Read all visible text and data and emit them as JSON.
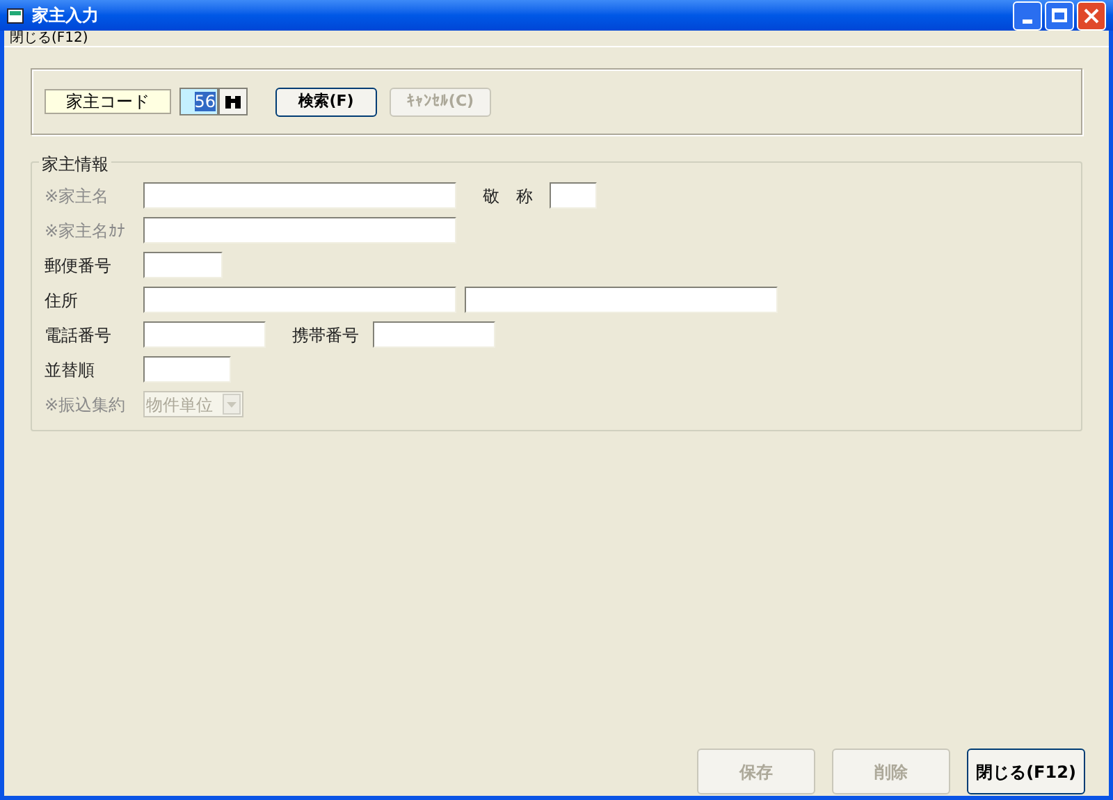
{
  "window": {
    "title": "家主入力"
  },
  "menu": [
    "閉じる(F12)"
  ],
  "search": {
    "code_label": "家主コード",
    "code_value": "56",
    "code_selected": true,
    "buttons": [
      {
        "label": "検索(F)",
        "disabled": false
      },
      {
        "label": "ｷｬﾝｾﾙ(C)",
        "disabled": true
      }
    ]
  },
  "group": {
    "title": "家主情報",
    "rows": [
      [
        {
          "label": "※家主名",
          "required": true,
          "kind": "text"
        },
        {
          "label": "敬　称",
          "required": false,
          "kind": "text"
        }
      ],
      [
        {
          "label": "※家主名ｶﾅ",
          "required": true,
          "kind": "text"
        }
      ],
      [
        {
          "label": "郵便番号",
          "required": false,
          "kind": "text"
        }
      ],
      [
        {
          "label": "住所",
          "required": false,
          "kind": "double"
        }
      ],
      [
        {
          "label": "電話番号",
          "required": false,
          "kind": "text"
        },
        {
          "label": "携帯番号",
          "required": false,
          "kind": "text"
        }
      ],
      [
        {
          "label": "並替順",
          "required": false,
          "kind": "text"
        }
      ],
      [
        {
          "label": "※振込集約",
          "required": true,
          "kind": "select",
          "value": "物件単位",
          "disabled": true
        }
      ]
    ]
  },
  "footer_buttons": [
    {
      "label": "保存",
      "disabled": true
    },
    {
      "label": "削除",
      "disabled": true
    },
    {
      "label": "閉じる(F12)",
      "disabled": false
    }
  ]
}
